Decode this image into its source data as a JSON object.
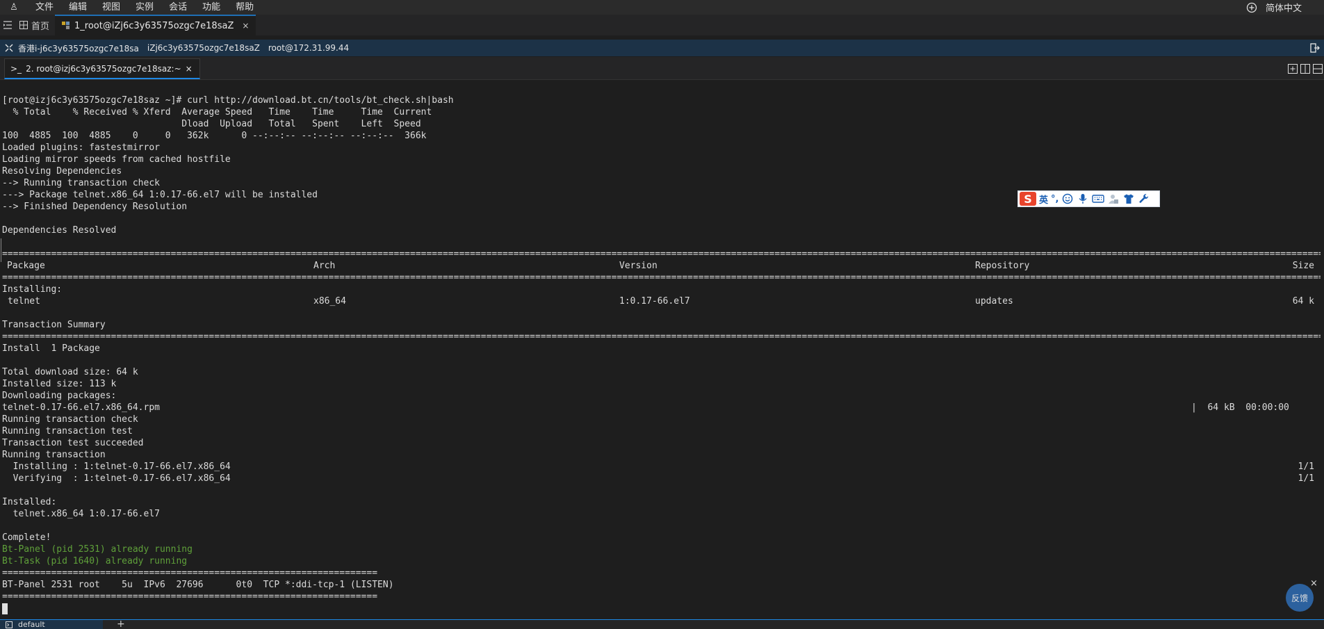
{
  "menubar": {
    "logo": "♙",
    "items": [
      "文件",
      "编辑",
      "视图",
      "实例",
      "会话",
      "功能",
      "帮助"
    ],
    "language": "简体中文"
  },
  "tabs": {
    "home_label": "首页",
    "active_label": "1_root@iZj6c3y63575ozgc7e18saZ",
    "close": "×"
  },
  "infobar": {
    "region": "香港i-j6c3y63575ozgc7e18sa",
    "instance": "iZj6c3y63575ozgc7e18saZ",
    "address": "root@172.31.99.44"
  },
  "terminal_tab": {
    "icon": ">_",
    "label": "2. root@izj6c3y63575ozgc7e18saz:~",
    "close": "×"
  },
  "terminal": {
    "top_lines": [
      "[root@izj6c3y63575ozgc7e18saz ~]# curl http://download.bt.cn/tools/bt_check.sh|bash",
      "  % Total    % Received % Xferd  Average Speed   Time    Time     Time  Current",
      "                                 Dload  Upload   Total   Spent    Left  Speed",
      "100  4885  100  4885    0     0   362k      0 --:--:-- --:--:-- --:--:--  366k",
      "Loaded plugins: fastestmirror",
      "Loading mirror speeds from cached hostfile",
      "Resolving Dependencies",
      "--> Running transaction check",
      "---> Package telnet.x86_64 1:0.17-66.el7 will be installed",
      "--> Finished Dependency Resolution",
      "",
      "Dependencies Resolved",
      ""
    ],
    "separator": "================================================================================================================================================================================================================================================================",
    "table_header": {
      "package": "Package",
      "arch": "Arch",
      "version": "Version",
      "repository": "Repository",
      "size": "Size"
    },
    "installing_label": "Installing:",
    "table_row": {
      "package": "telnet",
      "arch": "x86_64",
      "version": "1:0.17-66.el7",
      "repository": "updates",
      "size": "64 k"
    },
    "summary_label": "Transaction Summary",
    "mid_lines": [
      "Install  1 Package",
      "",
      "Total download size: 64 k",
      "Installed size: 113 k",
      "Downloading packages:"
    ],
    "download_file": "telnet-0.17-66.el7.x86_64.rpm",
    "download_progress": "|  64 kB  00:00:00",
    "run_lines": [
      "Running transaction check",
      "Running transaction test",
      "Transaction test succeeded",
      "Running transaction"
    ],
    "installing_step": "  Installing : 1:telnet-0.17-66.el7.x86_64",
    "installing_count": "1/1",
    "verifying_step": "  Verifying  : 1:telnet-0.17-66.el7.x86_64",
    "verifying_count": "1/1",
    "end_lines": [
      "",
      "Installed:",
      "  telnet.x86_64 1:0.17-66.el7",
      "",
      "Complete!"
    ],
    "green_lines": [
      "Bt-Panel (pid 2531) already running",
      "Bt-Task (pid 1640) already running"
    ],
    "short_separator": "=====================================================================",
    "listen_line": "BT-Panel 2531 root    5u  IPv6  27696      0t0  TCP *:ddi-tcp-1 (LISTEN)"
  },
  "ime": {
    "logo": "S",
    "lang": "英",
    "punct": "°,"
  },
  "feedback": {
    "label": "反馈",
    "close": "×"
  },
  "bottombar": {
    "tab_label": "default",
    "plus": "+"
  },
  "colors": {
    "accent": "#1e88e5",
    "info_bar": "#1c3247",
    "terminal_bg": "#1e1e1e",
    "green_text": "#5fa03a"
  }
}
